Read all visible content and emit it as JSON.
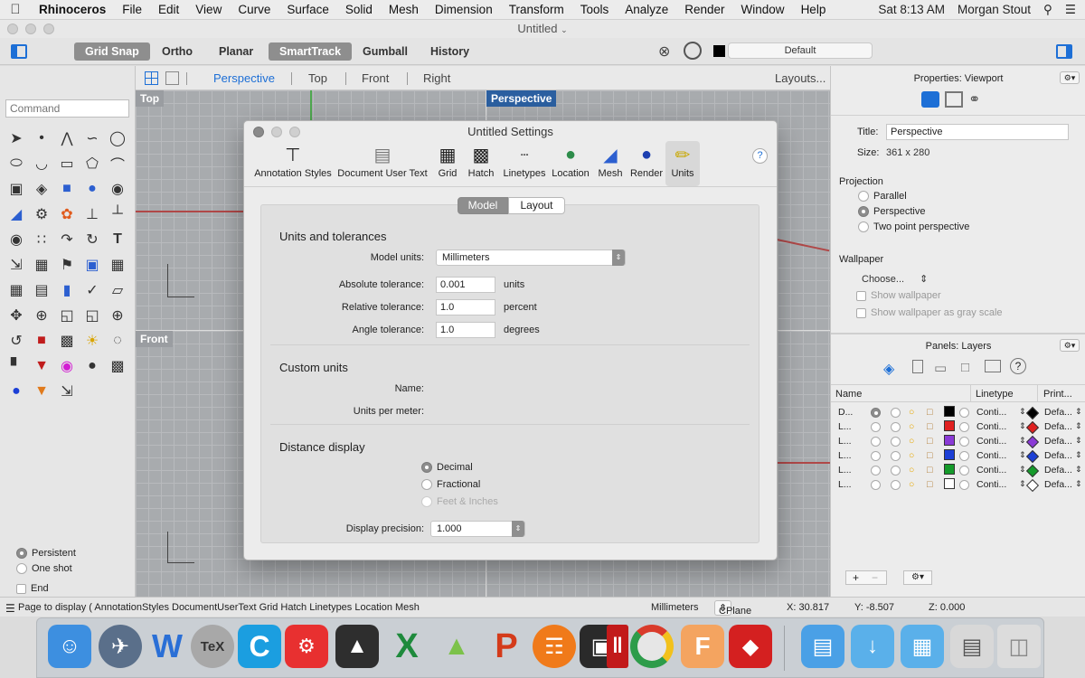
{
  "menubar": {
    "items": [
      "Rhinoceros",
      "File",
      "Edit",
      "View",
      "Curve",
      "Surface",
      "Solid",
      "Mesh",
      "Dimension",
      "Transform",
      "Tools",
      "Analyze",
      "Render",
      "Window",
      "Help"
    ],
    "clock": "Sat 8:13 AM",
    "user": "Morgan Stout"
  },
  "window": {
    "title": "Untitled"
  },
  "toolbar": {
    "grid_snap": "Grid Snap",
    "ortho": "Ortho",
    "planar": "Planar",
    "smarttrack": "SmartTrack",
    "gumball": "Gumball",
    "history": "History",
    "layer_default": "Default"
  },
  "left": {
    "command_placeholder": "Command",
    "persistent": "Persistent",
    "one_shot": "One shot",
    "end": "End"
  },
  "vtabs": {
    "perspective": "Perspective",
    "top": "Top",
    "front": "Front",
    "right": "Right",
    "layouts": "Layouts..."
  },
  "viewports": {
    "top": "Top",
    "perspective": "Perspective",
    "front": "Front"
  },
  "properties": {
    "header": "Properties: Viewport",
    "title_label": "Title:",
    "title_value": "Perspective",
    "size_label": "Size:",
    "size_value": "361 x 280",
    "projection": "Projection",
    "parallel": "Parallel",
    "perspective": "Perspective",
    "two_point": "Two point perspective",
    "wallpaper": "Wallpaper",
    "choose": "Choose...",
    "show_wallpaper": "Show wallpaper",
    "show_gray": "Show wallpaper as gray scale"
  },
  "layers": {
    "header": "Panels: Layers",
    "col_name": "Name",
    "col_linetype": "Linetype",
    "col_print": "Print...",
    "rows": [
      {
        "name": "D...",
        "linetype": "Conti...",
        "print": "Defa...",
        "color": "#000000"
      },
      {
        "name": "L...",
        "linetype": "Conti...",
        "print": "Defa...",
        "color": "#e02020"
      },
      {
        "name": "L...",
        "linetype": "Conti...",
        "print": "Defa...",
        "color": "#8a3ad6"
      },
      {
        "name": "L...",
        "linetype": "Conti...",
        "print": "Defa...",
        "color": "#1c3fd6"
      },
      {
        "name": "L...",
        "linetype": "Conti...",
        "print": "Defa...",
        "color": "#149a2a"
      },
      {
        "name": "L...",
        "linetype": "Conti...",
        "print": "Defa...",
        "color": "#ffffff"
      }
    ]
  },
  "status": {
    "command_line": "Page to display ( AnnotationStyles DocumentUserText Grid Hatch Linetypes Location Mesh",
    "units": "Millimeters",
    "cplane": "CPlane",
    "x": "X: 30.817",
    "y": "Y: -8.507",
    "z": "Z: 0.000"
  },
  "dialog": {
    "title": "Untitled Settings",
    "tabs": [
      "Annotation Styles",
      "Document User Text",
      "Grid",
      "Hatch",
      "Linetypes",
      "Location",
      "Mesh",
      "Render",
      "Units"
    ],
    "help": "?",
    "seg_model": "Model",
    "seg_layout": "Layout",
    "units_tol_title": "Units and tolerances",
    "model_units_label": "Model units:",
    "model_units_value": "Millimeters",
    "abs_tol_label": "Absolute tolerance:",
    "abs_tol_value": "0.001",
    "abs_tol_unit": "units",
    "rel_tol_label": "Relative tolerance:",
    "rel_tol_value": "1.0",
    "rel_tol_unit": "percent",
    "angle_tol_label": "Angle tolerance:",
    "angle_tol_value": "1.0",
    "angle_tol_unit": "degrees",
    "custom_title": "Custom units",
    "name_label": "Name:",
    "upm_label": "Units per meter:",
    "distance_title": "Distance display",
    "decimal": "Decimal",
    "fractional": "Fractional",
    "feet_inches": "Feet & Inches",
    "precision_label": "Display precision:",
    "precision_value": "1.000"
  }
}
